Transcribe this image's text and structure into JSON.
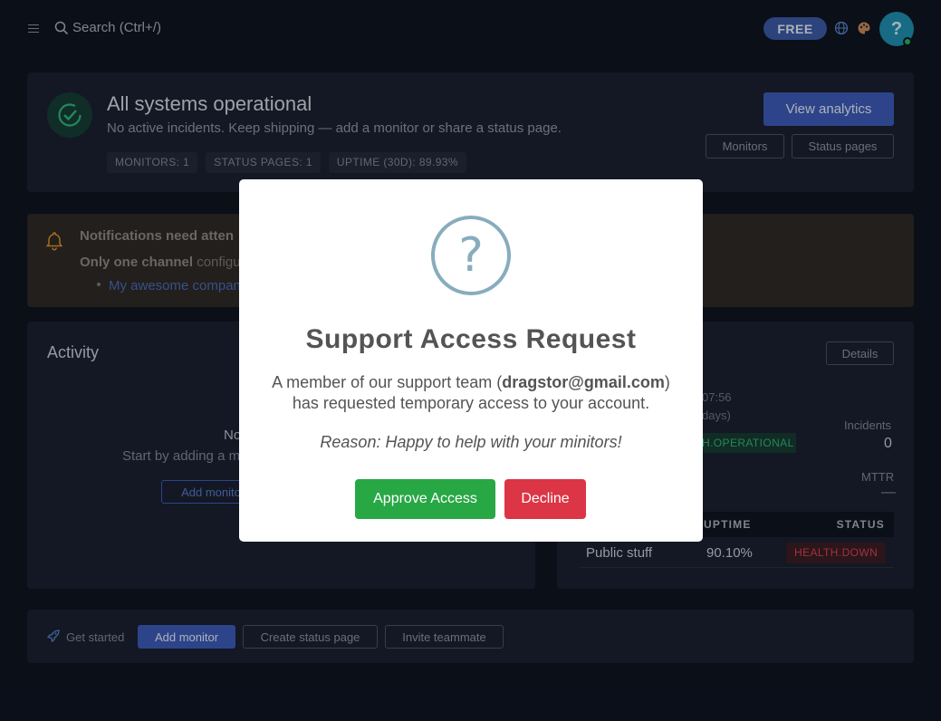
{
  "topbar": {
    "search_label": "Search (Ctrl+/)",
    "plan_badge": "FREE",
    "avatar_glyph": "?"
  },
  "status": {
    "title": "All systems operational",
    "subtitle": "No active incidents. Keep shipping — add a monitor or share a status page.",
    "stats": [
      "MONITORS: 1",
      "STATUS PAGES: 1",
      "UPTIME (30D): 89.93%"
    ],
    "view_analytics": "View analytics",
    "monitors": "Monitors",
    "status_pages": "Status pages"
  },
  "notifications": {
    "title": "Notifications need atten",
    "line_bold": "Only one channel",
    "line_rest": " configu",
    "link": "My awesome compan"
  },
  "activity": {
    "title": "Activity",
    "empty_title": "No",
    "empty_sub": "Start by adding a m",
    "add_button": "Add monito"
  },
  "summary": {
    "details": "Details",
    "time_fragment": "07:56",
    "days_fragment": "days)",
    "status_badge": "H.OPERATIONAL",
    "incidents_label": "Incidents",
    "incidents_value": "0",
    "mttr_label": "MTTR",
    "mttr_value": "—",
    "columns": {
      "uptime": "UPTIME",
      "status": "STATUS"
    },
    "rows": [
      {
        "name": "Public stuff",
        "uptime": "90.10%",
        "status": "HEALTH.DOWN"
      }
    ]
  },
  "get_started": {
    "label": "Get started",
    "add_monitor": "Add monitor",
    "create_status_page": "Create status page",
    "invite_teammate": "Invite teammate"
  },
  "modal": {
    "icon_glyph": "?",
    "title": "Support Access Request",
    "text_before": "A member of our support team (",
    "email": "dragstor@gmail.com",
    "text_after": ") has requested temporary access to your account.",
    "reason": "Reason: Happy to help with your minitors!",
    "approve": "Approve Access",
    "decline": "Decline"
  },
  "colors": {
    "background": "#0f1421",
    "card": "#1a2030",
    "primary": "#3d5bb8",
    "approve": "#28a745",
    "decline": "#dc3545",
    "question_icon": "#87adbd"
  }
}
